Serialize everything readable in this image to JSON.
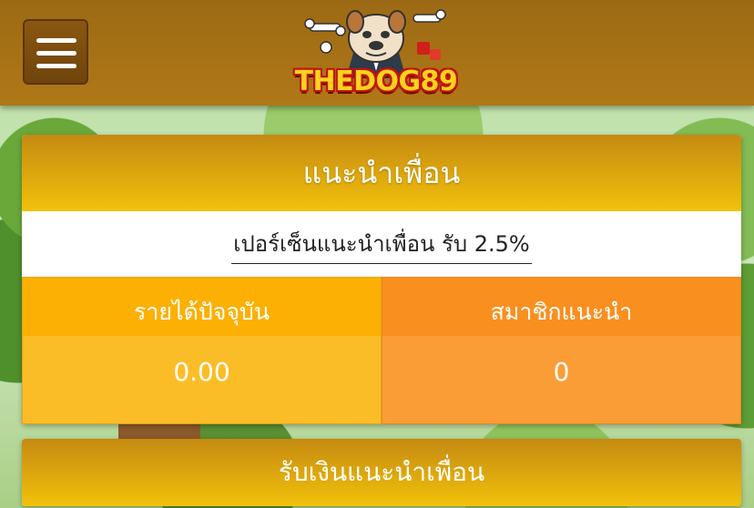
{
  "header": {
    "menu_icon": "hamburger-menu-icon",
    "logo_text": "THEDOG89",
    "logo_icon": "bulldog-mascot-icon"
  },
  "card": {
    "title": "แนะนำเพื่อน",
    "rate_text": "เปอร์เซ็นแนะนำเพื่อน รับ 2.5%"
  },
  "stats": {
    "income_label": "รายได้ปัจจุบัน",
    "income_value": "0.00",
    "members_label": "สมาชิกแนะนำ",
    "members_value": "0"
  },
  "actions": {
    "withdraw_label": "รับเงินแนะนำเพื่อน"
  },
  "colors": {
    "header": "#a8741a",
    "gold": "#f2c10a",
    "income_accent": "#fbb003",
    "members_accent": "#f98f1f"
  }
}
